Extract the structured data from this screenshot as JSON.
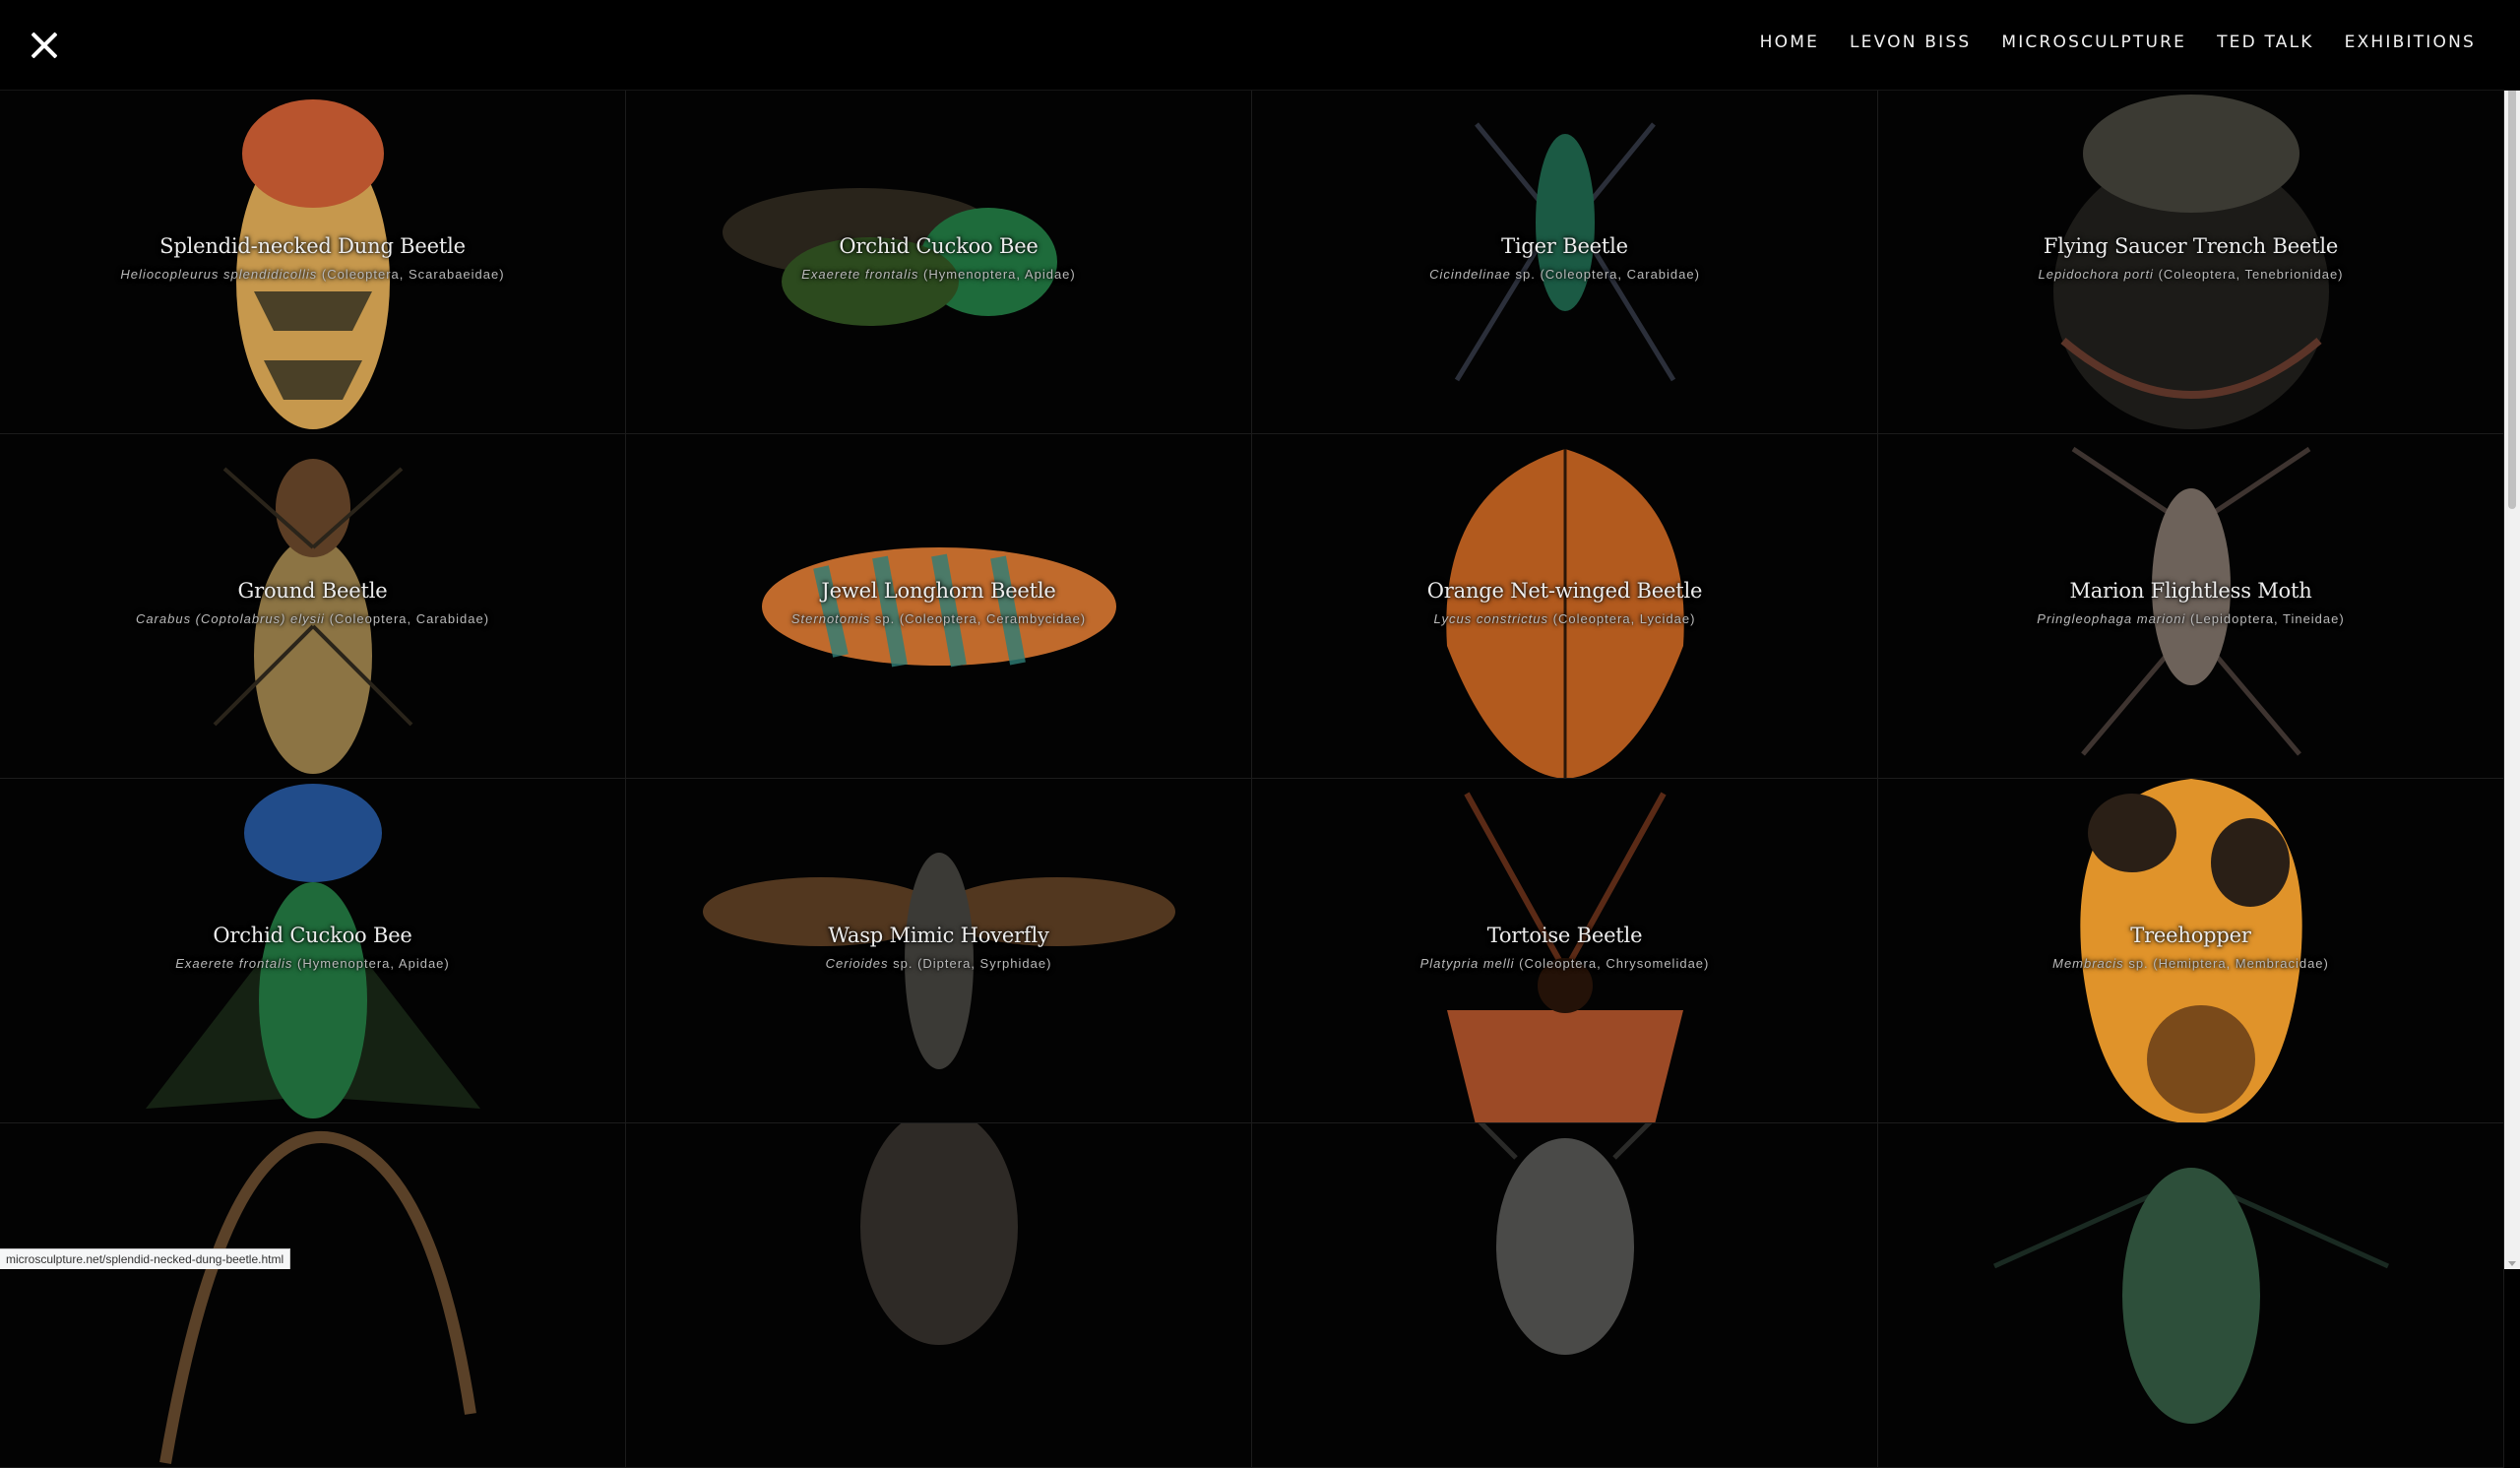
{
  "header": {
    "nav": [
      "HOME",
      "LEVON BISS",
      "MICROSCULPTURE",
      "TED TALK",
      "EXHIBITIONS"
    ]
  },
  "specimens": [
    {
      "common": "Splendid-necked Dung Beetle",
      "latin": "Heliocopleurus splendidicollis",
      "order": "(Coleoptera, Scarabaeidae)",
      "colors": [
        "#e9b35a",
        "#b8542e",
        "#2a2a1e"
      ]
    },
    {
      "common": "Orchid Cuckoo Bee",
      "latin": "Exaerete frontalis",
      "order": "(Hymenoptera, Apidae)",
      "colors": [
        "#1e6b3b",
        "#2c4a1e",
        "#3a3326"
      ]
    },
    {
      "common": "Tiger Beetle",
      "latin": "Cicindelinae",
      "order": "sp. (Coleoptera, Carabidae)",
      "colors": [
        "#1b5a44",
        "#2b2f3a",
        "#14161d"
      ]
    },
    {
      "common": "Flying Saucer Trench Beetle",
      "latin": "Lepidochora porti",
      "order": "(Coleoptera, Tenebrionidae)",
      "colors": [
        "#3b3a33",
        "#5b3428",
        "#1c1b18"
      ]
    },
    {
      "common": "Ground Beetle",
      "latin": "Carabus (Coptolabrus) elysii",
      "order": "(Coleoptera, Carabidae)",
      "colors": [
        "#8c7444",
        "#5c3e25",
        "#2a241a"
      ]
    },
    {
      "common": "Jewel Longhorn Beetle",
      "latin": "Sternotomis",
      "order": "sp. (Coleoptera, Cerambycidae)",
      "colors": [
        "#c06a2c",
        "#2f7f78",
        "#3a2a1a"
      ]
    },
    {
      "common": "Orange Net-winged Beetle",
      "latin": "Lycus constrictus",
      "order": "(Coleoptera, Lycidae)",
      "colors": [
        "#b25a1e",
        "#7c3a14",
        "#2a1608"
      ]
    },
    {
      "common": "Marion Flightless Moth",
      "latin": "Pringleophaga marioni",
      "order": "(Lepidoptera, Tineidae)",
      "colors": [
        "#6d625a",
        "#3e3430",
        "#201a17"
      ]
    },
    {
      "common": "Orchid Cuckoo Bee",
      "latin": "Exaerete frontalis",
      "order": "(Hymenoptera, Apidae)",
      "colors": [
        "#1f6a3a",
        "#214c8a",
        "#1a2a18"
      ]
    },
    {
      "common": "Wasp Mimic Hoverfly",
      "latin": "Cerioides",
      "order": "sp. (Diptera, Syrphidae)",
      "colors": [
        "#3b3a36",
        "#6d4a2a",
        "#1b1a18"
      ]
    },
    {
      "common": "Tortoise Beetle",
      "latin": "Platypria melli",
      "order": "(Coleoptera, Chrysomelidae)",
      "colors": [
        "#9c4a26",
        "#5a2a16",
        "#241208"
      ]
    },
    {
      "common": "Treehopper",
      "latin": "Membracis",
      "order": "sp. (Hemiptera, Membracidae)",
      "colors": [
        "#e0932a",
        "#2a1f16",
        "#7a4a1a"
      ]
    },
    {
      "common": "",
      "latin": "",
      "order": "",
      "colors": [
        "#5a4128",
        "#2a1e12",
        "#141008"
      ]
    },
    {
      "common": "",
      "latin": "",
      "order": "",
      "colors": [
        "#2e2a26",
        "#1c1916",
        "#0f0e0c"
      ]
    },
    {
      "common": "",
      "latin": "",
      "order": "",
      "colors": [
        "#4a4a48",
        "#2a2a28",
        "#161615"
      ]
    },
    {
      "common": "",
      "latin": "",
      "order": "",
      "colors": [
        "#2d4f3a",
        "#1a2a22",
        "#0f1612"
      ]
    }
  ],
  "status_url": "microsculpture.net/splendid-necked-dung-beetle.html"
}
